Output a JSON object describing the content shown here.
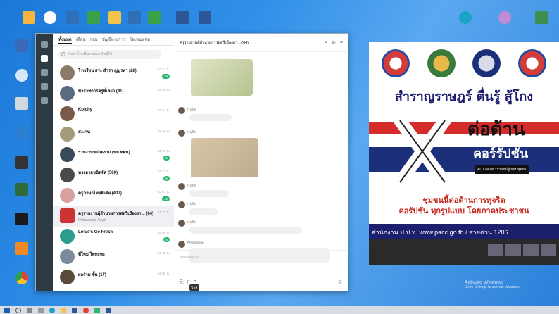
{
  "desktop": {
    "icons_top": [
      "",
      "",
      "",
      "",
      "",
      "",
      "",
      "",
      "",
      ""
    ],
    "icons_right": [
      "",
      "",
      ""
    ],
    "icons_left": [
      "",
      "",
      "",
      "",
      "",
      "",
      "",
      "",
      "",
      ""
    ]
  },
  "line": {
    "tabs": [
      "ทั้งหมด",
      "เพื่อน",
      "กลุ่ม",
      "บัญชีทางการ",
      "โอเพนแชท"
    ],
    "search_placeholder": "ค้นหาโดยชื่อแชทและชื่อผู้ใช้",
    "chats": [
      {
        "name": "โรงเรียน สระ สำรา ญบูรพา (28)",
        "preview": "",
        "time": "10:51 น.",
        "badge": "19",
        "color": "#8a7a66"
      },
      {
        "name": "ข้าราชการครูพี่เลยว (41)",
        "preview": "",
        "time": "10:50 น.",
        "badge": "",
        "color": "#5a6a80"
      },
      {
        "name": "Kolchy",
        "preview": "",
        "time": "10:51 น.",
        "badge": "",
        "color": "#7a5a48"
      },
      {
        "name": "ส่งงาน",
        "preview": "",
        "time": "10:52 น.",
        "badge": "",
        "color": "#a59a7a"
      },
      {
        "name": "ร่วมงานหน่วยงาน (ชม.ทดน)",
        "preview": "",
        "time": "10:26 น.",
        "badge": "5",
        "color": "#3a4a5a"
      },
      {
        "name": "ทวงลายชนิดจัด (500)",
        "preview": "",
        "time": "10:21 น.",
        "badge": "6",
        "color": "#4a4a4a"
      },
      {
        "name": "ครูภาษาไทยพิเศษ (407)",
        "preview": "",
        "time": "10:07 น.",
        "badge": "42",
        "color": "#d7a0a0"
      },
      {
        "name": "ครูรายงานผู้อำนวยการสตรีเมืองยา... (64)",
        "preview": "Phitsanulop Aoyd",
        "time": "10:37 น.",
        "badge": "",
        "color": "#c33",
        "selected": true
      },
      {
        "name": "Lotus's Go Fresh",
        "preview": "",
        "time": "10:08 น.",
        "badge": "6",
        "color": "#2a9d8f"
      },
      {
        "name": "พี่ใหม่ โพทะพร",
        "preview": "",
        "time": "10:02 น.",
        "badge": "",
        "color": "#7a8a9a"
      },
      {
        "name": "ผอร่วม ขั้น (17)",
        "preview": "",
        "time": "10:05 น.",
        "badge": "",
        "color": "#5a4a3a"
      }
    ],
    "chat_title": "ครูรายงานผู้อำนวยการสตรีเมืองยา... (64)",
    "messages": [
      {
        "sender": "ก.สุนิท",
        "text": ""
      },
      {
        "sender": "ก.สุนิท",
        "text": ""
      },
      {
        "sender": "ก.สุนิท",
        "text": ""
      },
      {
        "sender": "ก.สุนิท",
        "text": ""
      },
      {
        "sender": "ก.สุนิท",
        "text": ""
      },
      {
        "sender": "Phitsanulop",
        "text": ""
      }
    ],
    "composer_placeholder": "ป้อนข้อความ",
    "tooltip": "ไฟล์"
  },
  "poster": {
    "headline": "สำราญราษฎร์ ตื่นรู้ สู้โกง",
    "anti_line1": "ต่อต้าน",
    "anti_line2": "คอร์รัปชั่น",
    "actnow": "ACT NOW : ร่วมกันสู้ ทอนทุจริต",
    "slogan1": "ชุมชนนี้ต่อต้านการทุจริต",
    "slogan2": "คอรัปชั่น ทุกรูปแบบ โดยภาคประชาชน",
    "footer": "สำนักงาน ป.ป.ท. www.pacc.go.th / สายด่วน 1206"
  },
  "activate": {
    "line1": "Activate Windows",
    "line2": "Go to Settings to activate Windows."
  },
  "taskbar": {
    "time": "",
    "date": ""
  }
}
